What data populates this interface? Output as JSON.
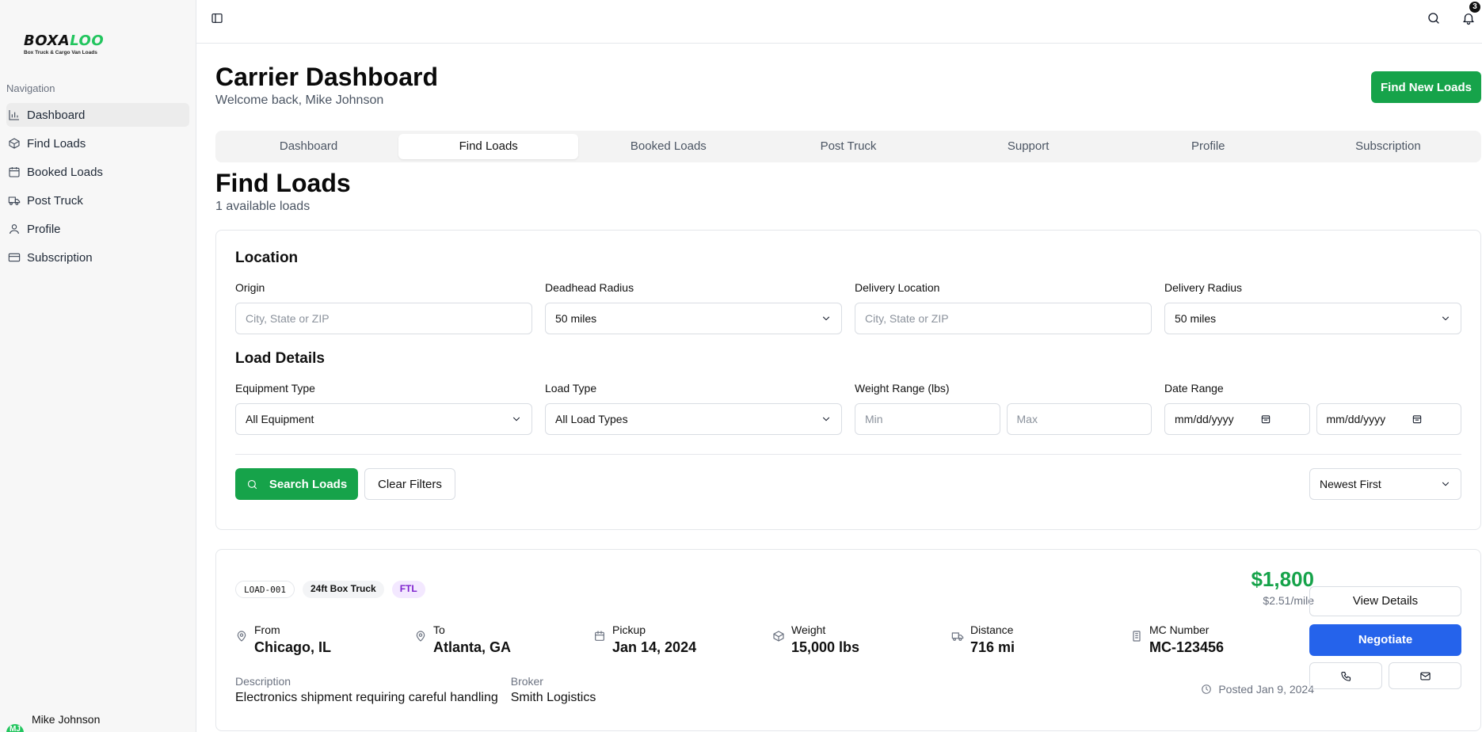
{
  "brand": {
    "name_part1": "BOXA",
    "name_part2": "LOO",
    "tagline": "Box Truck & Cargo Van Loads",
    "accent": "#22c55e"
  },
  "sidebar": {
    "heading": "Navigation",
    "items": [
      {
        "label": "Dashboard",
        "icon": "bar-chart-icon",
        "active": true
      },
      {
        "label": "Find Loads",
        "icon": "package-icon",
        "active": false
      },
      {
        "label": "Booked Loads",
        "icon": "calendar-icon",
        "active": false
      },
      {
        "label": "Post Truck",
        "icon": "truck-icon",
        "active": false
      },
      {
        "label": "Profile",
        "icon": "user-icon",
        "active": false
      },
      {
        "label": "Subscription",
        "icon": "credit-card-icon",
        "active": false
      }
    ],
    "user": {
      "name": "Mike Johnson",
      "initials": "MJ"
    }
  },
  "topbar": {
    "notification_count": "3"
  },
  "header": {
    "title": "Carrier Dashboard",
    "subtitle": "Welcome back, Mike Johnson",
    "cta": "Find New Loads"
  },
  "tabs": [
    {
      "label": "Dashboard",
      "active": false
    },
    {
      "label": "Find Loads",
      "active": true
    },
    {
      "label": "Booked Loads",
      "active": false
    },
    {
      "label": "Post Truck",
      "active": false
    },
    {
      "label": "Support",
      "active": false
    },
    {
      "label": "Profile",
      "active": false
    },
    {
      "label": "Subscription",
      "active": false
    }
  ],
  "find_loads": {
    "title": "Find Loads",
    "count_text": "1 available loads",
    "filters": {
      "location_title": "Location",
      "origin": {
        "label": "Origin",
        "placeholder": "City, State or ZIP"
      },
      "deadhead": {
        "label": "Deadhead Radius",
        "value": "50 miles"
      },
      "delivery": {
        "label": "Delivery Location",
        "placeholder": "City, State or ZIP"
      },
      "delivery_radius": {
        "label": "Delivery Radius",
        "value": "50 miles"
      },
      "details_title": "Load Details",
      "equipment": {
        "label": "Equipment Type",
        "value": "All Equipment"
      },
      "load_type": {
        "label": "Load Type",
        "value": "All Load Types"
      },
      "weight": {
        "label": "Weight Range (lbs)",
        "min_placeholder": "Min",
        "max_placeholder": "Max"
      },
      "date": {
        "label": "Date Range",
        "from_placeholder": "mm/dd/yyyy",
        "to_placeholder": "mm/dd/yyyy"
      },
      "search_button": "Search Loads",
      "clear_button": "Clear Filters",
      "sort": "Newest First"
    },
    "loads": [
      {
        "id": "LOAD-001",
        "equipment": "24ft Box Truck",
        "load_type": "FTL",
        "from_label": "From",
        "from": "Chicago, IL",
        "to_label": "To",
        "to": "Atlanta, GA",
        "pickup_label": "Pickup",
        "pickup": "Jan 14, 2024",
        "weight_label": "Weight",
        "weight": "15,000 lbs",
        "distance_label": "Distance",
        "distance": "716 mi",
        "mc_label": "MC Number",
        "mc": "MC-123456",
        "description_label": "Description",
        "description": "Electronics shipment requiring careful handling",
        "broker_label": "Broker",
        "broker": "Smith Logistics",
        "price": "$1,800",
        "rate": "$2.51/mile",
        "posted": "Posted Jan 9, 2024",
        "view_button": "View Details",
        "negotiate_button": "Negotiate"
      }
    ]
  },
  "colors": {
    "green": "#16a34a",
    "blue": "#2563eb",
    "purple_badge": "#7e22ce"
  }
}
